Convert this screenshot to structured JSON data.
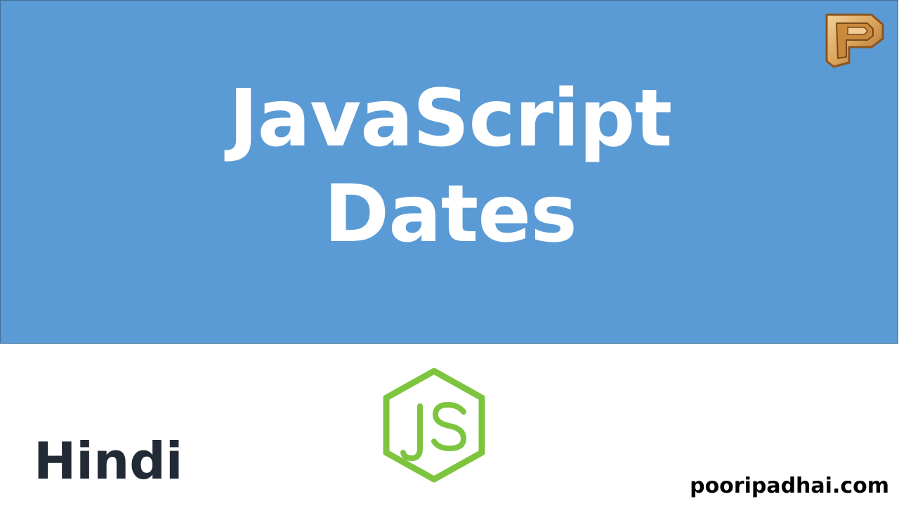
{
  "banner": {
    "title_line1": "JavaScript",
    "title_line2": "Dates",
    "background_color": "#5b9bd5",
    "text_color": "#ffffff"
  },
  "logo": {
    "icon": "p-logo-icon"
  },
  "js_logo": {
    "icon": "nodejs-hexagon-icon",
    "color": "#7dc53e"
  },
  "footer": {
    "language_label": "Hindi",
    "website": "pooripadhai.com"
  }
}
